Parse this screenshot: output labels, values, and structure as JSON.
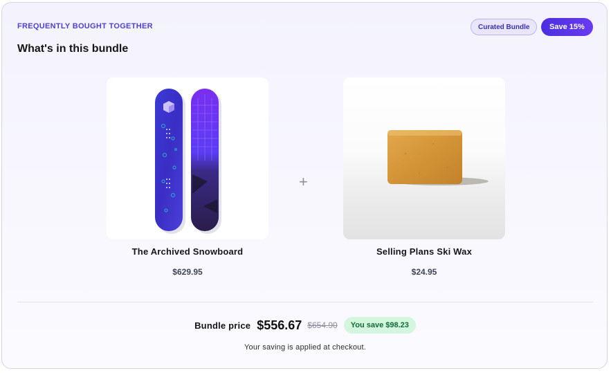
{
  "header": {
    "eyebrow": "FREQUENTLY BOUGHT TOGETHER",
    "title": "What's in this bundle",
    "badge_curated": "Curated Bundle",
    "badge_save": "Save 15%"
  },
  "products": [
    {
      "name": "The Archived Snowboard",
      "price": "$629.95",
      "image": "snowboard-image"
    },
    {
      "name": "Selling Plans Ski Wax",
      "price": "$24.95",
      "image": "ski-wax-image"
    }
  ],
  "separator": "+",
  "bundle": {
    "label": "Bundle price",
    "price": "$556.67",
    "compare_price": "$654.90",
    "savings": "You save $98.23",
    "note": "Your saving is applied at checkout."
  },
  "colors": {
    "accent": "#4f3fd6",
    "save_badge": "#5a35e8",
    "savings_bg": "#d4f6de",
    "savings_text": "#0f6b35"
  }
}
